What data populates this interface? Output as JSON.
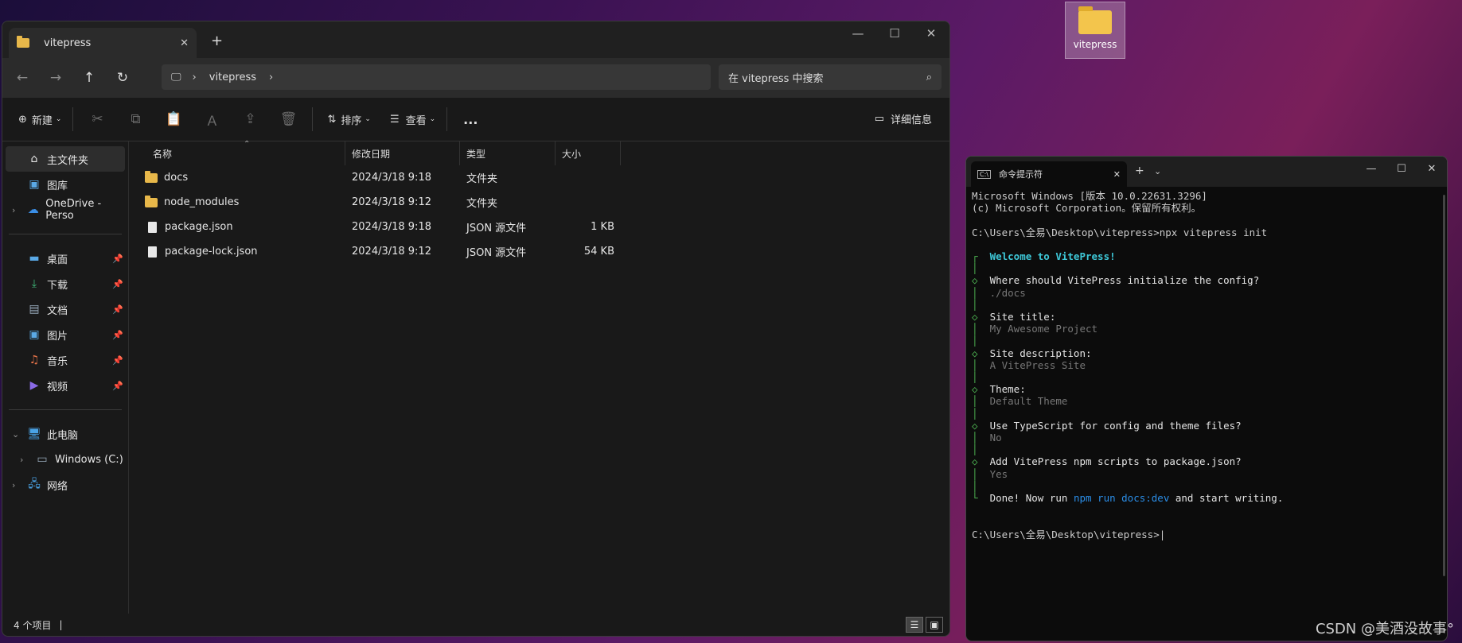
{
  "explorer": {
    "tab_title": "vitepress",
    "address_crumb": "vitepress",
    "search_placeholder": "在 vitepress 中搜索",
    "toolbar": {
      "new_label": "新建",
      "sort_label": "排序",
      "view_label": "查看",
      "more_label": "...",
      "details_label": "详细信息"
    },
    "nav": {
      "home": "主文件夹",
      "gallery": "图库",
      "onedrive": "OneDrive - Perso",
      "desktop": "桌面",
      "downloads": "下载",
      "documents": "文档",
      "pictures": "图片",
      "music": "音乐",
      "videos": "视频",
      "this_pc": "此电脑",
      "windows_c": "Windows (C:)",
      "network": "网络"
    },
    "columns": {
      "name": "名称",
      "date": "修改日期",
      "type": "类型",
      "size": "大小"
    },
    "files": [
      {
        "name": "docs",
        "date": "2024/3/18 9:18",
        "type": "文件夹",
        "size": ""
      },
      {
        "name": "node_modules",
        "date": "2024/3/18 9:12",
        "type": "文件夹",
        "size": ""
      },
      {
        "name": "package.json",
        "date": "2024/3/18 9:18",
        "type": "JSON 源文件",
        "size": "1 KB"
      },
      {
        "name": "package-lock.json",
        "date": "2024/3/18 9:12",
        "type": "JSON 源文件",
        "size": "54 KB"
      }
    ],
    "status": "4 个项目"
  },
  "desktop_icon": {
    "label": "vitepress"
  },
  "terminal": {
    "tab_title": "命令提示符",
    "lines": {
      "l1": "Microsoft Windows [版本 10.0.22631.3296]",
      "l2": "(c) Microsoft Corporation。保留所有权利。",
      "prompt_cmd": "C:\\Users\\全易\\Desktop\\vitepress>npx vitepress init",
      "welcome": "Welcome to VitePress!",
      "q1": "Where should VitePress initialize the config?",
      "a1": "./docs",
      "q2": "Site title:",
      "a2": "My Awesome Project",
      "q3": "Site description:",
      "a3": "A VitePress Site",
      "q4": "Theme:",
      "a4": "Default Theme",
      "q5": "Use TypeScript for config and theme files?",
      "a5": "No",
      "q6": "Add VitePress npm scripts to package.json?",
      "a6": "Yes",
      "done_pre": "Done! Now run ",
      "done_cmd": "npm run docs:dev",
      "done_post": " and start writing.",
      "final_prompt": "C:\\Users\\全易\\Desktop\\vitepress>"
    }
  },
  "watermark": "CSDN @美酒没故事°"
}
